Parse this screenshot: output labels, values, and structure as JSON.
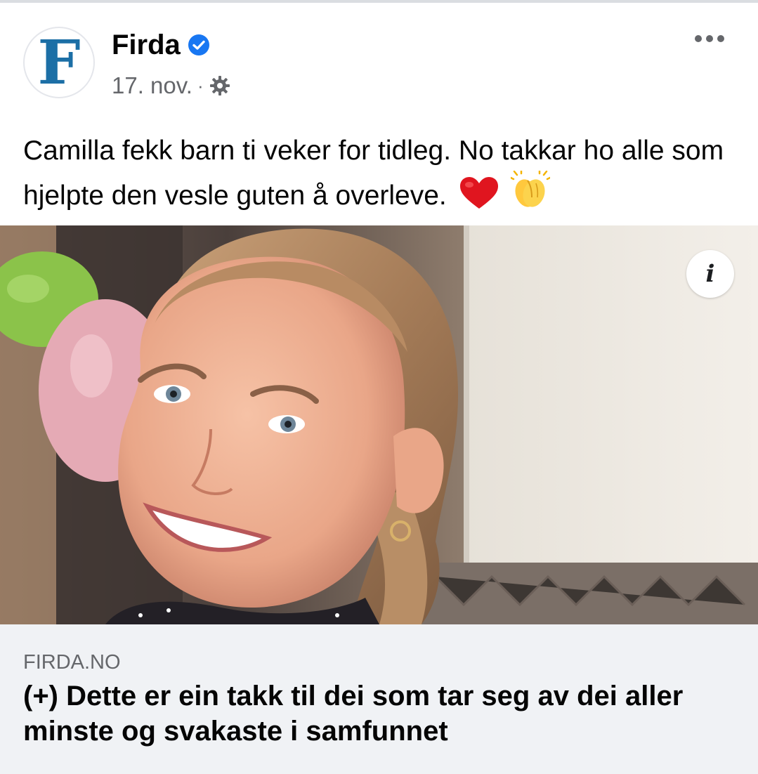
{
  "post": {
    "page_name": "Firda",
    "avatar_letter": "F",
    "date": "17. nov.",
    "separator": "·",
    "text": "Camilla fekk barn ti veker for tidleg. No takkar ho alle som hjelpte den vesle guten å overleve.",
    "emojis": [
      "red-heart",
      "clapping-hands"
    ]
  },
  "link_preview": {
    "domain": "FIRDA.NO",
    "title": "(+) Dette er ein takk til dei som tar seg av dei aller minste og svakaste i samfunnet"
  },
  "photo": {
    "info_glyph": "i"
  },
  "colors": {
    "brand_blue": "#1c6fa6",
    "verified_blue": "#1877f2",
    "secondary_text": "#65676b",
    "link_bg": "#f0f2f5"
  }
}
